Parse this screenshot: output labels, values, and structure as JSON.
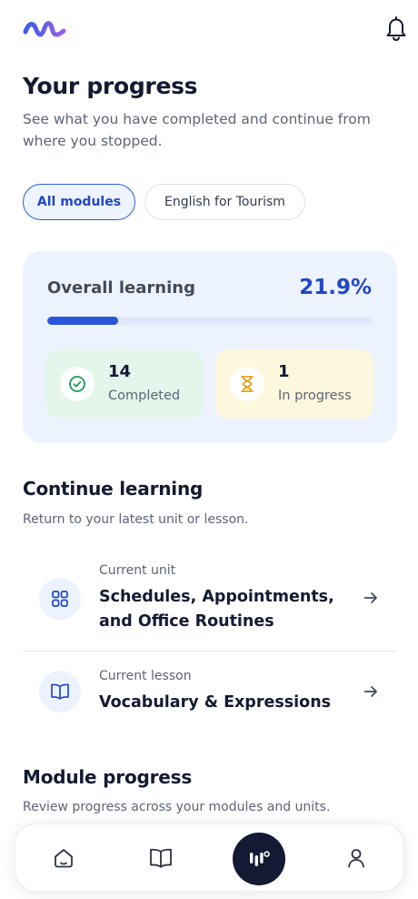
{
  "header": {
    "logo_icon": "wave-logo-icon",
    "notification_icon": "bell-icon"
  },
  "page": {
    "title": "Your progress",
    "subtitle": "See what you have completed and continue from where you stopped."
  },
  "filters": {
    "items": [
      {
        "label": "All modules",
        "active": true
      },
      {
        "label": "English for Tourism",
        "active": false
      }
    ]
  },
  "overall": {
    "label": "Overall learning",
    "percent_text": "21.9%",
    "progress_fraction": 0.219,
    "completed": {
      "count": "14",
      "label": "Completed",
      "icon": "check-circle-icon"
    },
    "in_progress": {
      "count": "1",
      "label": "In progress",
      "icon": "hourglass-icon"
    }
  },
  "continue_learning": {
    "title": "Continue learning",
    "subtitle": "Return to your latest unit or lesson.",
    "items": [
      {
        "kicker": "Current unit",
        "title": "Schedules, Appointments, and Office Routines",
        "icon": "grid-icon"
      },
      {
        "kicker": "Current lesson",
        "title": "Vocabulary & Expressions",
        "icon": "book-open-icon"
      }
    ]
  },
  "module_progress": {
    "title": "Module progress",
    "subtitle": "Review progress across your modules and units."
  },
  "bottom_nav": {
    "items": [
      "home-icon",
      "book-icon",
      "voice-assistant-icon",
      "profile-icon"
    ]
  },
  "colors": {
    "accent": "#2247c6",
    "card_bg": "#edf3fe",
    "completed_bg": "#e4f5ec",
    "in_progress_bg": "#fdf7dd",
    "nav_center": "#141a33"
  }
}
